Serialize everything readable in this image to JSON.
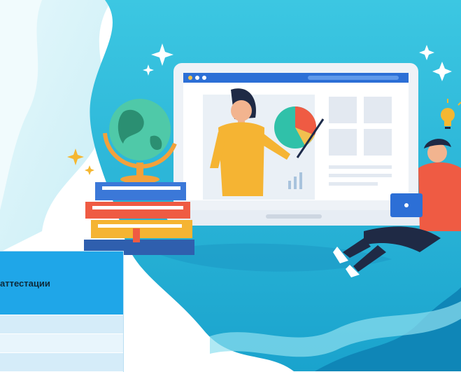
{
  "table": {
    "header_text": "аттестации"
  },
  "colors": {
    "wave": "#27b8d8",
    "table_header": "#1fa6e8",
    "row_a": "#d5ecf9",
    "row_b": "#e8f5fc"
  },
  "icons": [
    "sparkle-icon",
    "globe-icon",
    "books-icon",
    "laptop-icon",
    "pie-chart-icon",
    "lightbulb-icon",
    "teacher-icon",
    "student-icon"
  ]
}
